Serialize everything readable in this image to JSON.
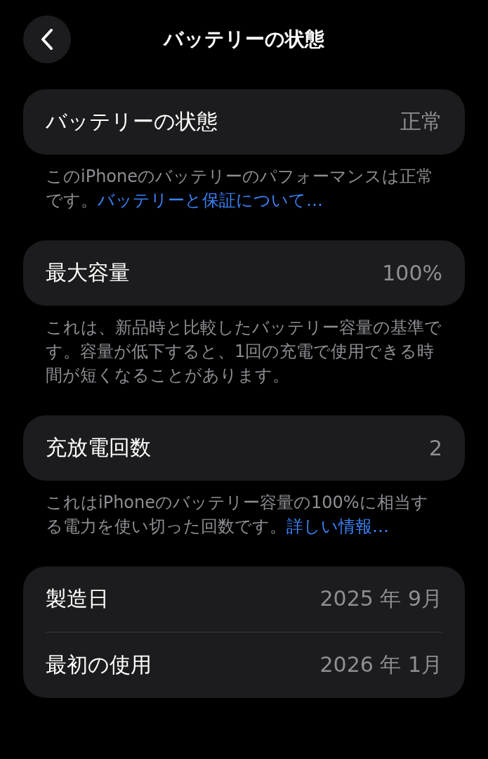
{
  "header": {
    "title": "バッテリーの状態"
  },
  "sections": [
    {
      "rows": [
        {
          "label": "バッテリーの状態",
          "value": "正常"
        }
      ],
      "footer": {
        "text": "このiPhoneのバッテリーのパフォーマンスは正常です。",
        "link": "バッテリーと保証について…"
      }
    },
    {
      "rows": [
        {
          "label": "最大容量",
          "value": "100%"
        }
      ],
      "footer": {
        "text": "これは、新品時と比較したバッテリー容量の基準です。容量が低下すると、1回の充電で使用できる時間が短くなることがあります。"
      }
    },
    {
      "rows": [
        {
          "label": "充放電回数",
          "value": "2"
        }
      ],
      "footer": {
        "text": "これはiPhoneのバッテリー容量の100%に相当する電力を使い切った回数です。",
        "link": "詳しい情報…"
      }
    },
    {
      "rows": [
        {
          "label": "製造日",
          "value": "2025 年 9月"
        },
        {
          "label": "最初の使用",
          "value": "2026 年 1月"
        }
      ]
    }
  ]
}
